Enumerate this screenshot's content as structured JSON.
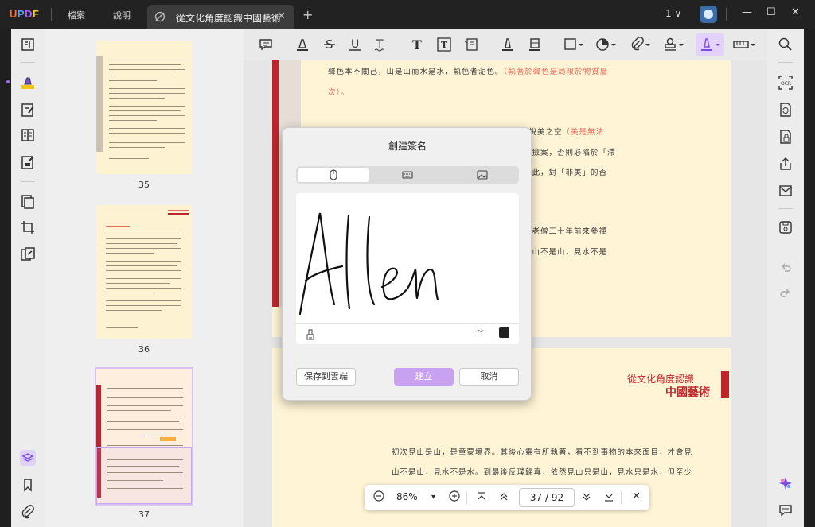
{
  "app": {
    "logo_text": "UPDF",
    "menu": [
      "檔案",
      "說明"
    ],
    "tab_title": "從文化角度認識中國藝術",
    "tab_close": "✕",
    "new_tab": "+",
    "page_indicator": "1 ∨",
    "window_controls": [
      "—",
      "☐",
      "✕"
    ]
  },
  "thumbnails": [
    {
      "label": "35"
    },
    {
      "label": "36"
    },
    {
      "label": "37"
    }
  ],
  "document": {
    "page1_lines": [
      {
        "text": "聲色本不關己，山是山而水是水，執色者泥色。",
        "red": "（執著於聲色是局限於物質層"
      },
      {
        "text": "",
        "red": "次）。"
      },
      {
        "text": "而說美之空",
        "red": "（美是無法"
      },
      {
        "text": "至撿案，否則必陷於「滯"
      },
      {
        "text": "因此，對「非美」的否"
      },
      {
        "text": "「老僧三十年前來參禪"
      },
      {
        "text": "見山不是山，見水不是"
      }
    ],
    "page2_heading_small": "從文化角度認識",
    "page2_heading_large": "中國藝術",
    "page2_lines": [
      "初次見山是山，是童蒙境界。其後心靈有所執著，看不到事物的本來面目，才會見",
      "山不是山，見水不是水。到最後反璞歸真，依然見山只是山，見水只是水，但至少"
    ]
  },
  "dialog": {
    "title": "創建簽名",
    "signature_text": "Allen",
    "save_to_cloud": "保存到雲端",
    "create": "建立",
    "cancel": "取消",
    "stroke_symbol": "~"
  },
  "zoom_bar": {
    "minus": "−",
    "zoom": "86%",
    "dropdown": "▾",
    "plus": "+",
    "page": "37 / 92",
    "close": "✕"
  },
  "colors": {
    "accent_purple": "#c8a2f0",
    "page_bg": "#fff5d6",
    "heading_red": "#c0242b"
  }
}
